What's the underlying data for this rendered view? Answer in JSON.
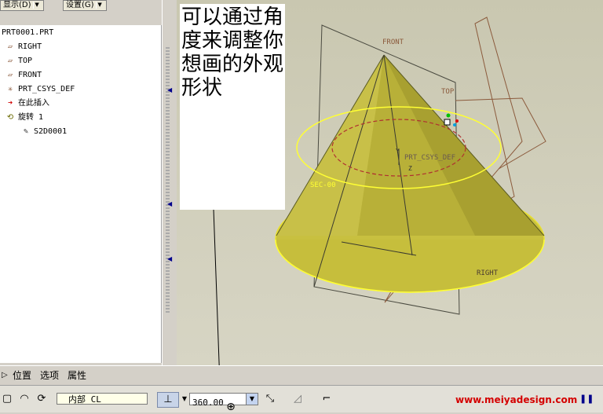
{
  "menu": {
    "display_label": "显示(D)",
    "settings_label": "设置(G)"
  },
  "model_tree": {
    "items": [
      {
        "label": "PRT0001.PRT",
        "icon": "part-icon"
      },
      {
        "label": "RIGHT",
        "icon": "datum-plane-icon"
      },
      {
        "label": "TOP",
        "icon": "datum-plane-icon"
      },
      {
        "label": "FRONT",
        "icon": "datum-plane-icon"
      },
      {
        "label": "PRT_CSYS_DEF",
        "icon": "csys-icon"
      },
      {
        "label": "在此插入",
        "icon": "insert-here-arrow-icon"
      },
      {
        "label": "旋转 1",
        "icon": "revolve-icon"
      },
      {
        "label": "S2D0001",
        "icon": "sketch-icon"
      }
    ]
  },
  "annotation": {
    "text": "可以通过角度来调整你想画的外观形状"
  },
  "viewport": {
    "labels": {
      "front": "FRONT",
      "top": "TOP",
      "right": "RIGHT",
      "csys": "PRT_CSYS_DEF",
      "dimension": "SEC-00",
      "y_axis": "Y",
      "z_axis": "Z"
    },
    "colors": {
      "cone": "#c8c040",
      "highlight": "#ffff33",
      "datum": "#8b5a3c",
      "section": "#b03030"
    }
  },
  "dashboard": {
    "tabs": [
      "位置",
      "选项",
      "属性"
    ],
    "axis_field_value": "内部 CL",
    "angle_value": "360.00"
  },
  "watermark": "www.meiyadesign.com"
}
